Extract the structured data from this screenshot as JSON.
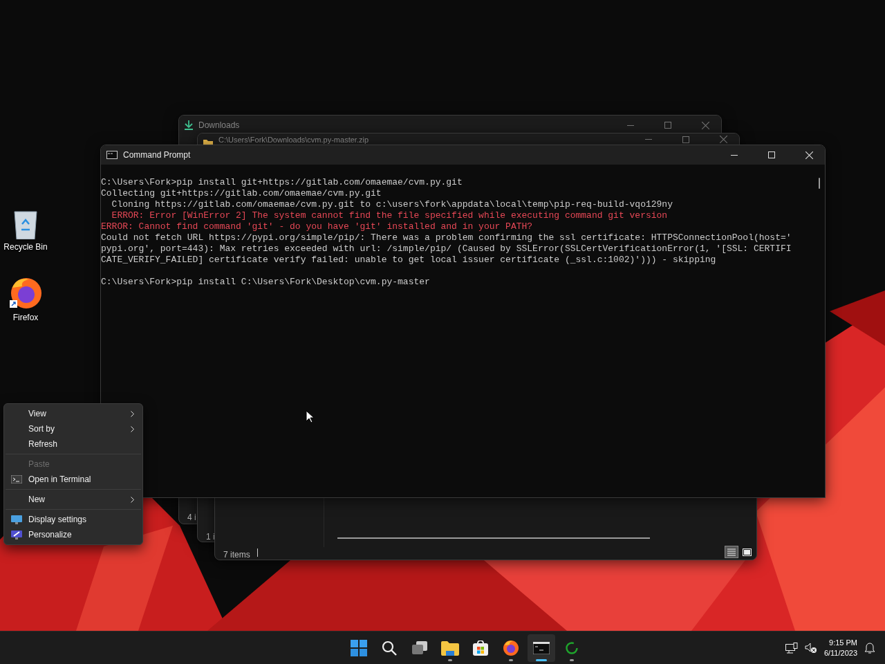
{
  "desktop_icons": [
    {
      "label": "Recycle Bin",
      "kind": "bin"
    },
    {
      "label": "Firefox",
      "kind": "firefox"
    }
  ],
  "downloads_window": {
    "title": "Downloads"
  },
  "zip_window": {
    "title": "C:\\Users\\Fork\\Downloads\\cvm.py-master.zip"
  },
  "back_windows": [
    {
      "status": "4 i"
    },
    {
      "status": "1 i"
    }
  ],
  "explorer_window": {
    "status": "7 items",
    "views": [
      {
        "kind": "details",
        "selected": true
      },
      {
        "kind": "tiles",
        "selected": false
      }
    ]
  },
  "command_prompt": {
    "title": "Command Prompt",
    "lines": [
      {
        "kind": "normal",
        "text": "C:\\Users\\Fork>pip install git+https://gitlab.com/omaemae/cvm.py.git"
      },
      {
        "kind": "normal",
        "text": "Collecting git+https://gitlab.com/omaemae/cvm.py.git"
      },
      {
        "kind": "normal",
        "text": "  Cloning https://gitlab.com/omaemae/cvm.py.git to c:\\users\\fork\\appdata\\local\\temp\\pip-req-build-vqo129ny"
      },
      {
        "kind": "error",
        "text": "  ERROR: Error [WinError 2] The system cannot find the file specified while executing command git version"
      },
      {
        "kind": "error",
        "text": "ERROR: Cannot find command 'git' - do you have 'git' installed and in your PATH?"
      },
      {
        "kind": "normal",
        "text": "Could not fetch URL https://pypi.org/simple/pip/: There was a problem confirming the ssl certificate: HTTPSConnectionPool(host='"
      },
      {
        "kind": "normal",
        "text": "pypi.org', port=443): Max retries exceeded with url: /simple/pip/ (Caused by SSLError(SSLCertVerificationError(1, '[SSL: CERTIFI"
      },
      {
        "kind": "normal",
        "text": "CATE_VERIFY_FAILED] certificate verify failed: unable to get local issuer certificate (_ssl.c:1002)'))) - skipping"
      },
      {
        "kind": "blank"
      },
      {
        "kind": "normal",
        "text": "C:\\Users\\Fork>pip install C:\\Users\\Fork\\Desktop\\cvm.py-master"
      }
    ]
  },
  "context_menu": [
    {
      "kind": "item",
      "label": "View",
      "submenu": true,
      "disabled": false
    },
    {
      "kind": "item",
      "label": "Sort by",
      "submenu": true,
      "disabled": false
    },
    {
      "kind": "item",
      "label": "Refresh",
      "submenu": false,
      "disabled": false
    },
    {
      "kind": "separator"
    },
    {
      "kind": "item",
      "label": "Paste",
      "submenu": false,
      "disabled": true
    },
    {
      "kind": "terminal",
      "label": "Open in Terminal",
      "submenu": false,
      "disabled": false
    },
    {
      "kind": "separator"
    },
    {
      "kind": "item",
      "label": "New",
      "submenu": true,
      "disabled": false
    },
    {
      "kind": "separator"
    },
    {
      "kind": "display",
      "label": "Display settings",
      "submenu": false,
      "disabled": false
    },
    {
      "kind": "personalize",
      "label": "Personalize",
      "submenu": false,
      "disabled": false
    }
  ],
  "taskbar": {
    "apps": [
      {
        "kind": "start",
        "running": false,
        "selected": false
      },
      {
        "kind": "search",
        "running": false,
        "selected": false
      },
      {
        "kind": "taskview",
        "running": false,
        "selected": false
      },
      {
        "kind": "explorer",
        "running": true,
        "selected": false
      },
      {
        "kind": "store",
        "running": false,
        "selected": false
      },
      {
        "kind": "firefox",
        "running": true,
        "selected": false
      },
      {
        "kind": "terminal",
        "running": true,
        "selected": true
      },
      {
        "kind": "spinner",
        "running": true,
        "selected": false
      }
    ],
    "time": "9:15 PM",
    "date": "6/11/2023"
  }
}
